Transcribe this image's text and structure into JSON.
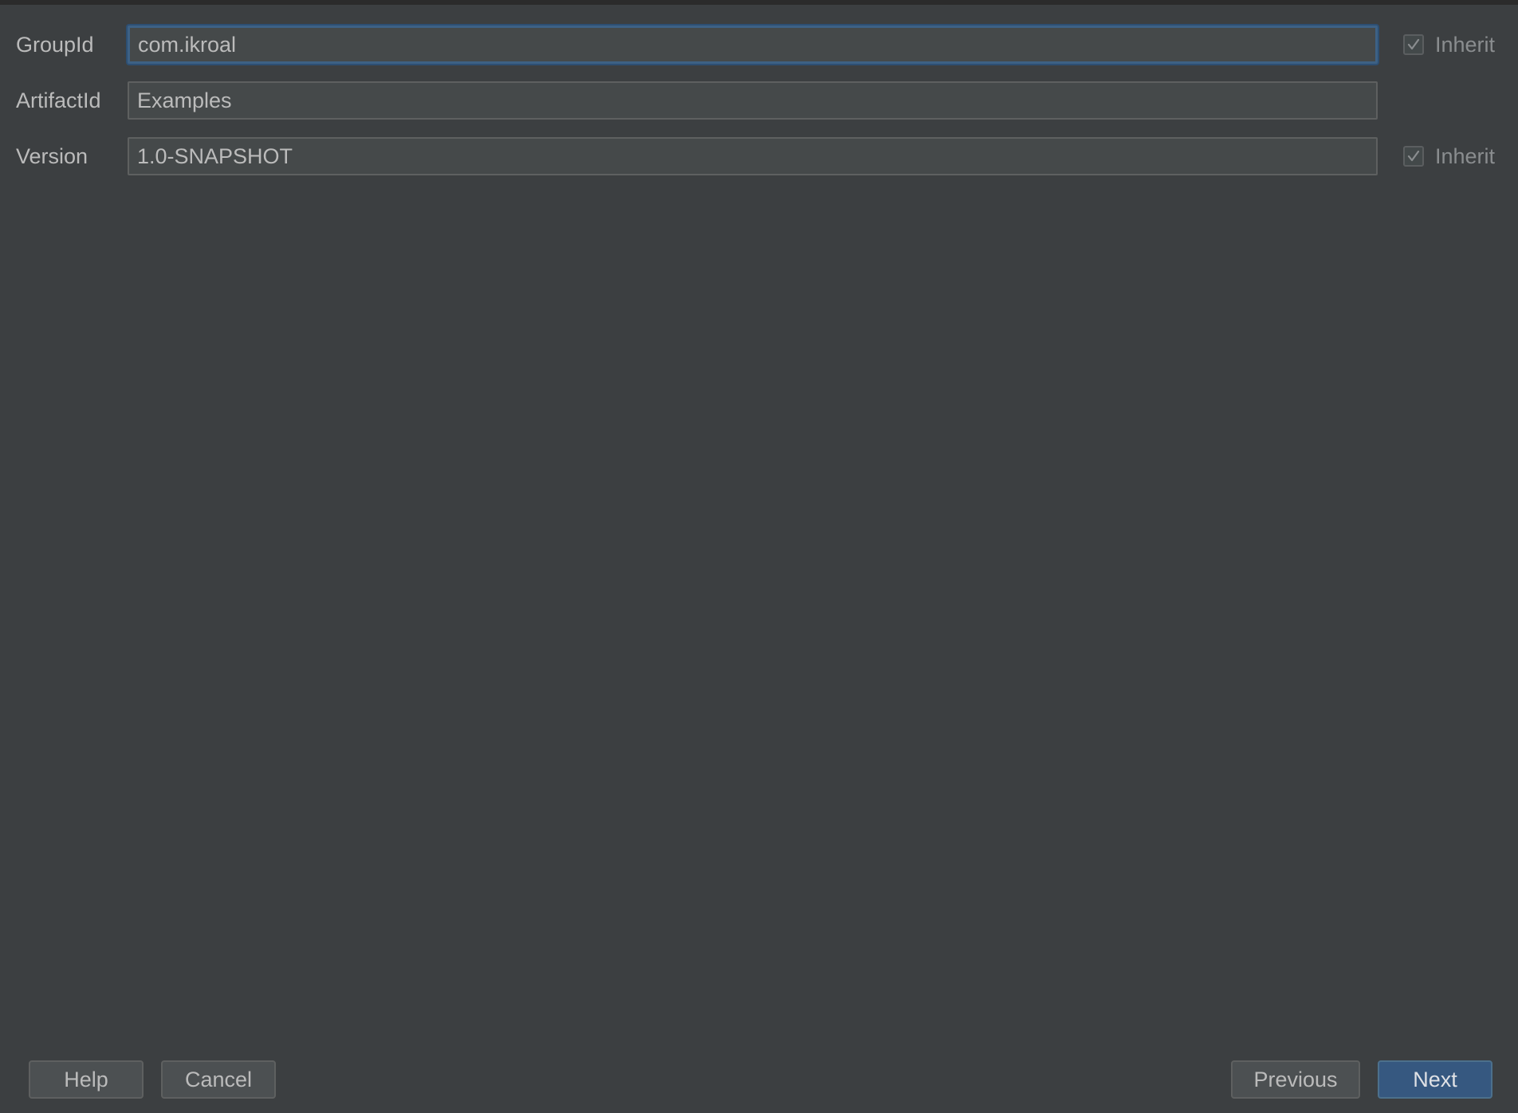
{
  "form": {
    "group_id": {
      "label": "GroupId",
      "value": "com.ikroal",
      "inherit_label": "Inherit",
      "inherit_checked": true
    },
    "artifact_id": {
      "label": "ArtifactId",
      "value": "Examples"
    },
    "version": {
      "label": "Version",
      "value": "1.0-SNAPSHOT",
      "inherit_label": "Inherit",
      "inherit_checked": true
    }
  },
  "buttons": {
    "help": "Help",
    "cancel": "Cancel",
    "previous": "Previous",
    "next": "Next"
  },
  "colors": {
    "background": "#3c3f41",
    "field_background": "#45494a",
    "focus_border": "#3d6185",
    "primary_button": "#365880"
  },
  "icons": {
    "inherit_checkbox": "checkmark-icon"
  }
}
